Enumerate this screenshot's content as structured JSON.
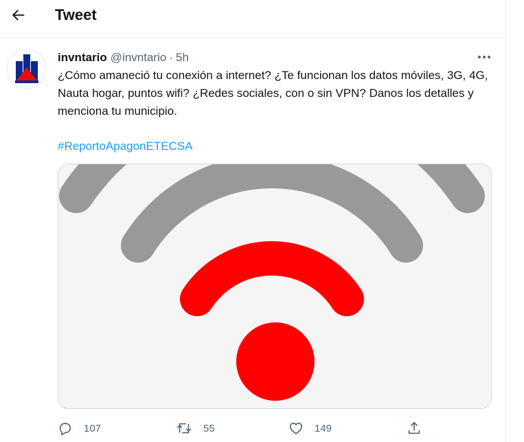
{
  "header": {
    "title": "Tweet",
    "back_icon": "arrow-left-icon"
  },
  "tweet": {
    "author_name": "invntario",
    "author_handle": "@invntario",
    "separator": "·",
    "time": "5h",
    "text": "¿Cómo amaneció tu conexión a internet? ¿Te funcionan los datos móviles, 3G, 4G, Nauta hogar, puntos wifi? ¿Redes sociales, con o sin VPN? Danos los detalles y menciona tu municipio.",
    "hashtag": "#ReportoApagonETECSA",
    "media": {
      "type": "wifi-signal-image",
      "colors": {
        "background": "#f5f5f5",
        "outer_arcs": "#999999",
        "inner": "#ff0000"
      }
    }
  },
  "actions": {
    "reply": {
      "icon": "reply-icon",
      "count": "107"
    },
    "retweet": {
      "icon": "retweet-icon",
      "count": "55"
    },
    "like": {
      "icon": "heart-icon",
      "count": "149"
    },
    "share": {
      "icon": "share-icon"
    }
  },
  "colors": {
    "accent": "#1d9bf0",
    "text": "#0f1419",
    "secondary": "#536471",
    "border": "#eff3f4"
  }
}
